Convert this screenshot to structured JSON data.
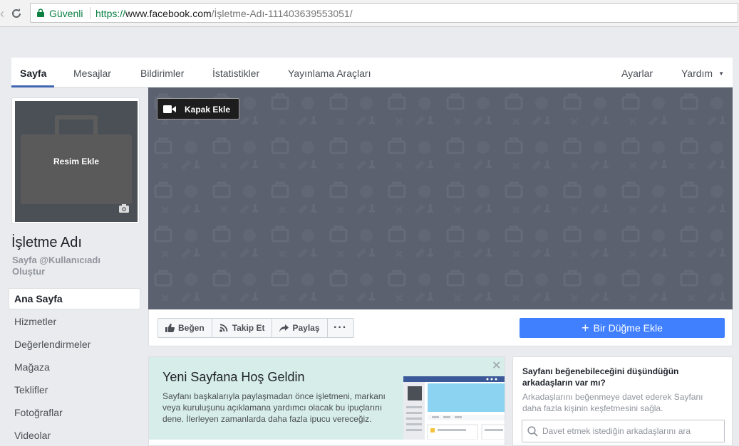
{
  "browser": {
    "secure_label": "Güvenli",
    "url_protocol": "https://",
    "url_host": "www.facebook.com",
    "url_path": "/İşletme-Adı-111403639553051/"
  },
  "tabs": {
    "items": [
      "Sayfa",
      "Mesajlar",
      "Bildirimler",
      "İstatistikler",
      "Yayınlama Araçları"
    ],
    "settings": "Ayarlar",
    "help": "Yardım"
  },
  "profile": {
    "add_photo": "Resim Ekle",
    "page_name": "İşletme Adı",
    "username_cta": "Sayfa @Kullanıcıadı Oluştur"
  },
  "side_nav": {
    "items": [
      "Ana Sayfa",
      "Hizmetler",
      "Değerlendirmeler",
      "Mağaza",
      "Teklifler",
      "Fotoğraflar",
      "Videolar"
    ]
  },
  "cover": {
    "add_cover": "Kapak Ekle"
  },
  "actions": {
    "like": "Beğen",
    "follow": "Takip Et",
    "share": "Paylaş",
    "more": "···",
    "add_button": "Bir Düğme Ekle"
  },
  "welcome": {
    "title": "Yeni Sayfana Hoş Geldin",
    "text": "Sayfanı başkalarıyla paylaşmadan önce işletmeni, markanı veya kuruluşunu açıklamana yardımcı olacak bu ipuçlarını dene. İlerleyen zamanlarda daha fazla ipucu vereceğiz."
  },
  "invite": {
    "title": "Sayfanı beğenebileceğini düşündüğün arkadaşların var mı?",
    "description": "Arkadaşlarını beğenmeye davet ederek Sayfanı daha fazla kişinin keşfetmesini sağla.",
    "search_placeholder": "Davet etmek istediğin arkadaşlarını ara"
  },
  "colors": {
    "brand_blue": "#4267b2",
    "cta_blue": "#4080ff",
    "cover_gray": "#5b616e",
    "welcome_bg": "#d7ede9",
    "secure_green": "#0b8043"
  }
}
